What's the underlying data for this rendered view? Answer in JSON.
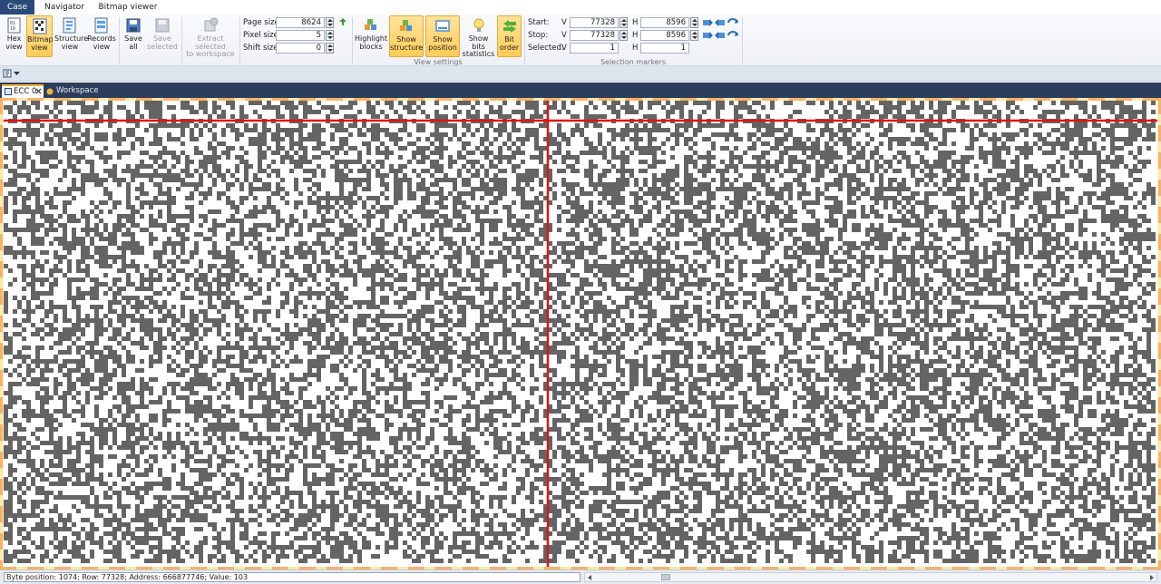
{
  "tabs": {
    "case": "Case",
    "navigator": "Navigator",
    "bitmap_viewer": "Bitmap viewer"
  },
  "ribbon": {
    "hex_view": [
      "Hex",
      "view"
    ],
    "bitmap_view": [
      "Bitmap",
      "view"
    ],
    "structure_view": [
      "Structure",
      "view"
    ],
    "records_view": [
      "Records",
      "view"
    ],
    "save_all": [
      "Save",
      "all"
    ],
    "save_selected": [
      "Save",
      "selected"
    ],
    "extract_selected": [
      "Extract selected",
      "to workspace"
    ],
    "page_size_label": "Page size",
    "page_size_value": "8624",
    "pixel_size_label": "Pixel size",
    "pixel_size_value": "5",
    "shift_size_label": "Shift size",
    "shift_size_value": "0",
    "highlight_blocks": [
      "Highlight",
      "blocks"
    ],
    "show_structure": [
      "Show",
      "structure"
    ],
    "show_position": [
      "Show",
      "position"
    ],
    "show_bits_statistics": [
      "Show bits",
      "statistics"
    ],
    "bit_order": [
      "Bit",
      "order"
    ],
    "view_settings_caption": "View settings",
    "start_label": "Start:",
    "stop_label": "Stop:",
    "selected_label": "Selected:",
    "v_label": "V",
    "h_label": "H",
    "start_v": "77328",
    "start_h": "8596",
    "stop_v": "77328",
    "stop_h": "8596",
    "selected_v": "1",
    "selected_h": "1",
    "selection_markers_caption": "Selection markers"
  },
  "doc_tabs": {
    "ecc": "ECC 0",
    "workspace": "Workspace"
  },
  "status": {
    "text": "Byte position: 1074; Row: 77328; Address: 666877746; Value: 103"
  },
  "colors": {
    "pixel_on": "#646464",
    "pixel_off": "#ffffff",
    "marker_line": "#e01414",
    "active_button": "#ffcc57",
    "tab_case_bg": "#2b4a7a",
    "doc_tab_bar": "#2d3e5c"
  },
  "icons": [
    "hex-view-icon",
    "bitmap-view-icon",
    "structure-view-icon",
    "records-view-icon",
    "save-all-icon",
    "save-selected-icon",
    "extract-selected-icon",
    "refresh-icon",
    "highlight-blocks-icon",
    "show-structure-icon",
    "show-position-icon",
    "show-bits-statistics-icon",
    "bit-order-icon",
    "goto-icon",
    "close-icon",
    "workspace-icon"
  ]
}
